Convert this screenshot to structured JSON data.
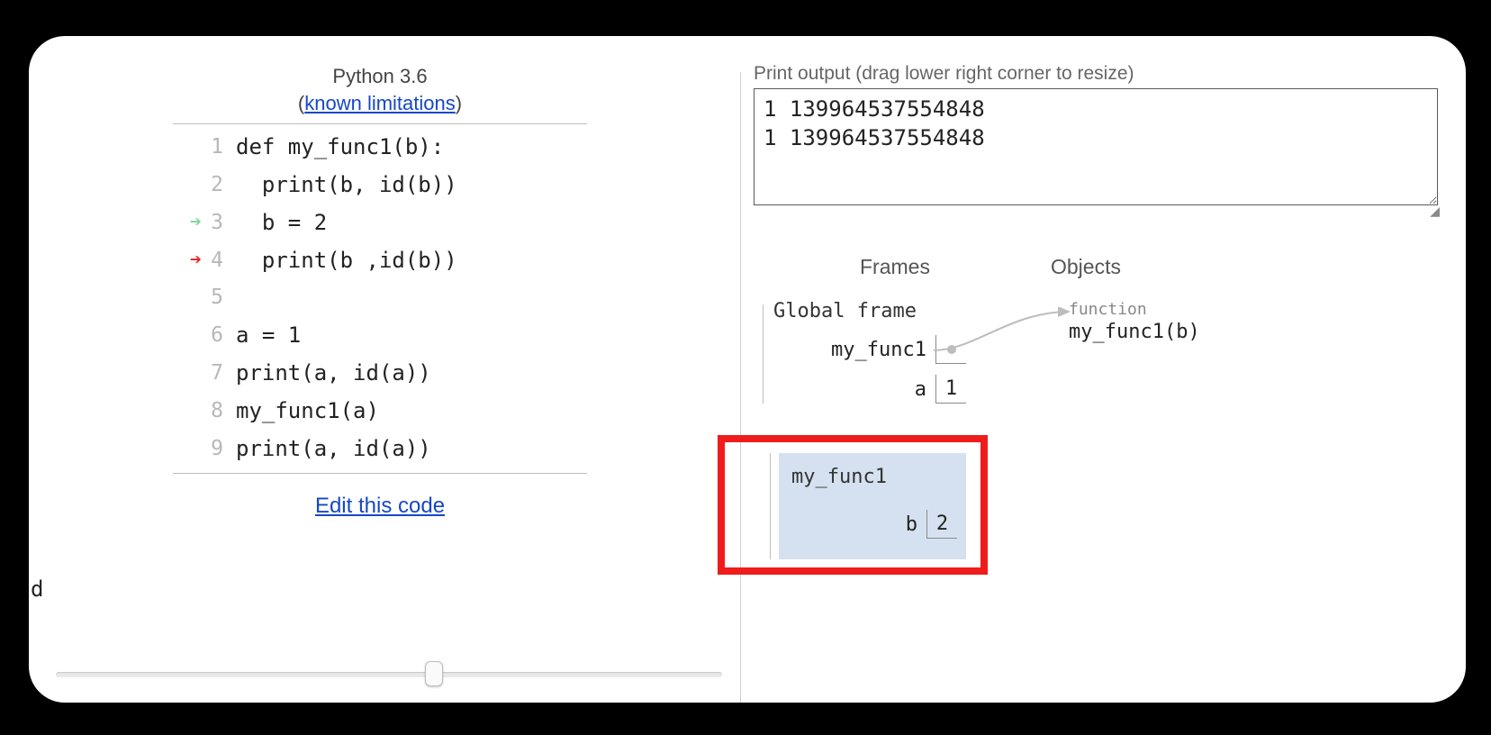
{
  "header": {
    "language": "Python 3.6",
    "limitations_label": "known limitations"
  },
  "code": {
    "lines": [
      {
        "n": "1",
        "txt": "def my_func1(b):"
      },
      {
        "n": "2",
        "txt": "  print(b, id(b))"
      },
      {
        "n": "3",
        "txt": "  b = 2",
        "arrow": "green"
      },
      {
        "n": "4",
        "txt": "  print(b ,id(b))",
        "arrow": "red"
      },
      {
        "n": "5",
        "txt": ""
      },
      {
        "n": "6",
        "txt": "a = 1"
      },
      {
        "n": "7",
        "txt": "print(a, id(a))"
      },
      {
        "n": "8",
        "txt": "my_func1(a)"
      },
      {
        "n": "9",
        "txt": "print(a, id(a))"
      }
    ],
    "edit_label": "Edit this code"
  },
  "stray_char": "d",
  "output": {
    "label": "Print output (drag lower right corner to resize)",
    "text": "1 139964537554848\n1 139964537554848"
  },
  "frames": {
    "frames_label": "Frames",
    "objects_label": "Objects",
    "global": {
      "title": "Global frame",
      "vars": [
        {
          "name": "my_func1",
          "val": ""
        },
        {
          "name": "a",
          "val": "1"
        }
      ]
    },
    "local": {
      "title": "my_func1",
      "var_name": "b",
      "var_val": "2"
    },
    "object": {
      "type": "function",
      "sig": "my_func1(b)"
    }
  }
}
